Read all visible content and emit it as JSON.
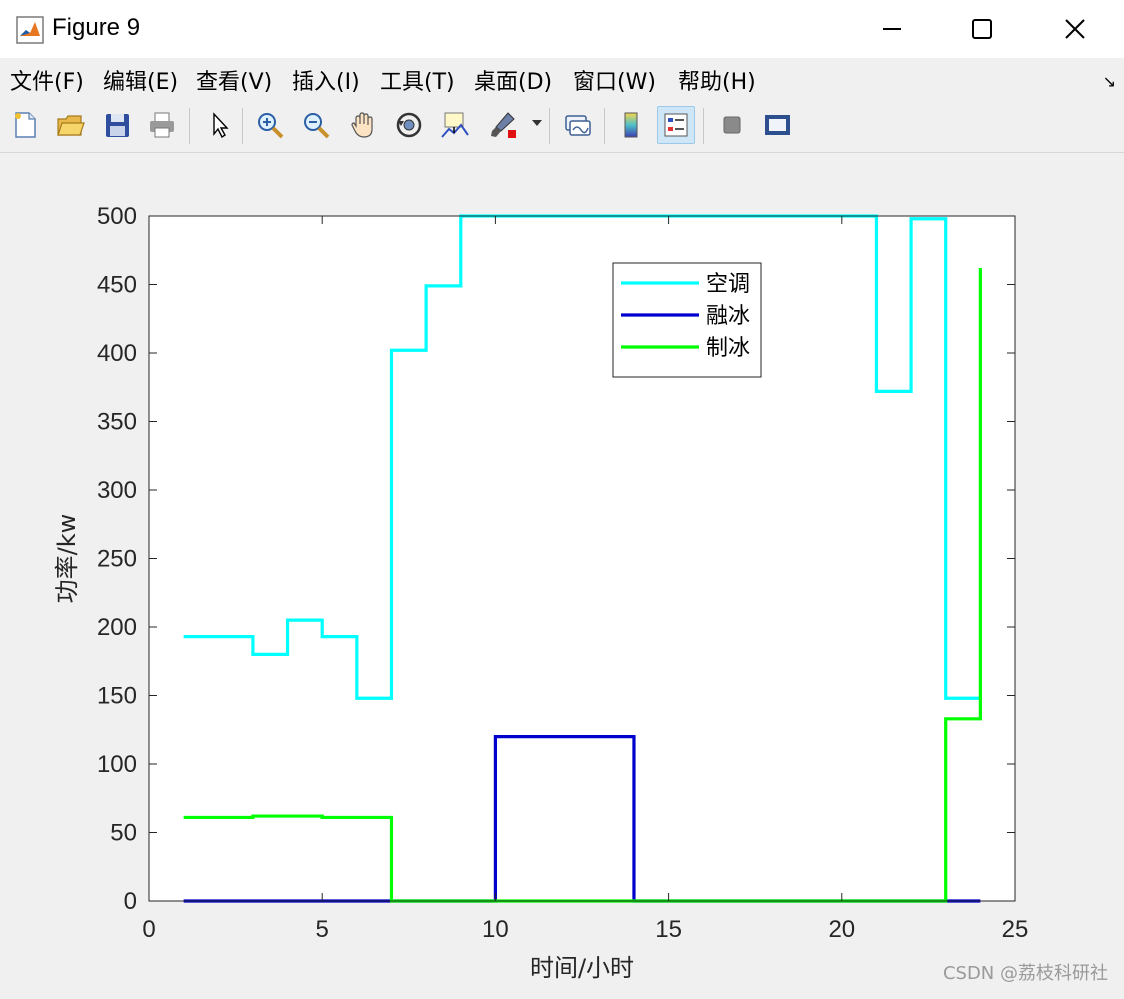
{
  "window": {
    "title": "Figure 9",
    "minimize_icon": "minimize-icon",
    "maximize_icon": "maximize-icon",
    "close_icon": "close-icon"
  },
  "menu": {
    "items": [
      "文件(F)",
      "编辑(E)",
      "查看(V)",
      "插入(I)",
      "工具(T)",
      "桌面(D)",
      "窗口(W)",
      "帮助(H)"
    ],
    "dock_arrow": "↘"
  },
  "toolbar": {
    "buttons": [
      "new-figure-icon",
      "open-file-icon",
      "save-icon",
      "print-icon",
      "select-arrow-icon",
      "zoom-in-icon",
      "zoom-out-icon",
      "pan-hand-icon",
      "rotate-3d-icon",
      "data-cursor-icon",
      "brush-icon",
      "link-plot-icon",
      "colorbar-icon",
      "legend-icon",
      "hide-plot-tools-icon",
      "show-plot-tools-icon"
    ]
  },
  "colors": {
    "ac": "#00ffff",
    "melt": "#0000cd",
    "ice": "#00ff00",
    "axes_bg": "#ffffff",
    "figure_bg": "#f0f0f0"
  },
  "chart_data": {
    "type": "line",
    "step": true,
    "title": "",
    "xlabel": "时间/小时",
    "ylabel": "功率/kw",
    "xlim": [
      0,
      25
    ],
    "ylim": [
      0,
      500
    ],
    "xticks": [
      0,
      5,
      10,
      15,
      20,
      25
    ],
    "yticks": [
      0,
      50,
      100,
      150,
      200,
      250,
      300,
      350,
      400,
      450,
      500
    ],
    "grid": false,
    "legend_position": "upper-right-inside",
    "series": [
      {
        "name": "空调",
        "color": "#00ffff",
        "x": [
          1,
          2,
          3,
          4,
          5,
          6,
          7,
          8,
          9,
          10,
          11,
          12,
          13,
          14,
          15,
          16,
          17,
          18,
          19,
          20,
          21,
          22,
          23,
          24
        ],
        "y": [
          193,
          193,
          180,
          205,
          193,
          148,
          402,
          449,
          500,
          500,
          500,
          500,
          500,
          500,
          500,
          500,
          500,
          500,
          500,
          500,
          372,
          498,
          148,
          148
        ]
      },
      {
        "name": "融冰",
        "color": "#0000cd",
        "x": [
          1,
          2,
          3,
          4,
          5,
          6,
          7,
          8,
          9,
          10,
          11,
          12,
          13,
          14,
          15,
          16,
          17,
          18,
          19,
          20,
          21,
          22,
          23,
          24
        ],
        "y": [
          0,
          0,
          0,
          0,
          0,
          0,
          0,
          0,
          0,
          120,
          120,
          120,
          120,
          0,
          0,
          0,
          0,
          0,
          0,
          0,
          0,
          0,
          0,
          0
        ]
      },
      {
        "name": "制冰",
        "color": "#00ff00",
        "x": [
          1,
          2,
          3,
          4,
          5,
          6,
          7,
          8,
          9,
          10,
          11,
          12,
          13,
          14,
          15,
          16,
          17,
          18,
          19,
          20,
          21,
          22,
          23,
          24
        ],
        "y": [
          61,
          61,
          62,
          62,
          61,
          61,
          0,
          0,
          0,
          0,
          0,
          0,
          0,
          0,
          0,
          0,
          0,
          0,
          0,
          0,
          0,
          0,
          133,
          462
        ]
      }
    ]
  },
  "watermark": "CSDN @荔枝科研社"
}
